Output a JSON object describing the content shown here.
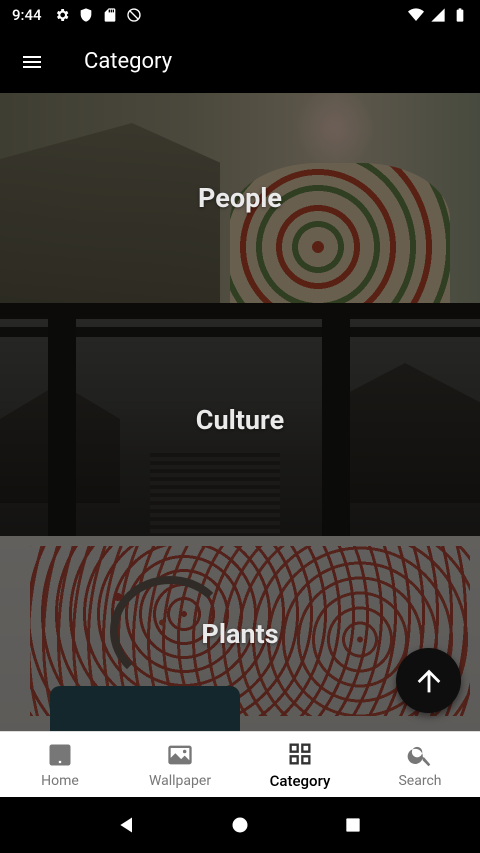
{
  "status": {
    "time": "9:44",
    "left_icons": [
      "settings-icon",
      "shield-icon",
      "sdcard-icon",
      "no-disturb-icon"
    ],
    "right_icons": [
      "wifi-icon",
      "signal-icon",
      "battery-icon"
    ]
  },
  "app_bar": {
    "title": "Category",
    "menu_icon": "hamburger-menu-icon"
  },
  "categories": [
    {
      "label": "People"
    },
    {
      "label": "Culture"
    },
    {
      "label": "Plants"
    }
  ],
  "fab": {
    "icon": "arrow-up-icon"
  },
  "bottom_nav": {
    "items": [
      {
        "label": "Home",
        "icon": "home-icon",
        "active": false
      },
      {
        "label": "Wallpaper",
        "icon": "wallpaper-icon",
        "active": false
      },
      {
        "label": "Category",
        "icon": "grid-icon",
        "active": true
      },
      {
        "label": "Search",
        "icon": "search-icon",
        "active": false
      }
    ]
  },
  "system_nav": [
    "back-icon",
    "home-circle-icon",
    "recents-icon"
  ]
}
